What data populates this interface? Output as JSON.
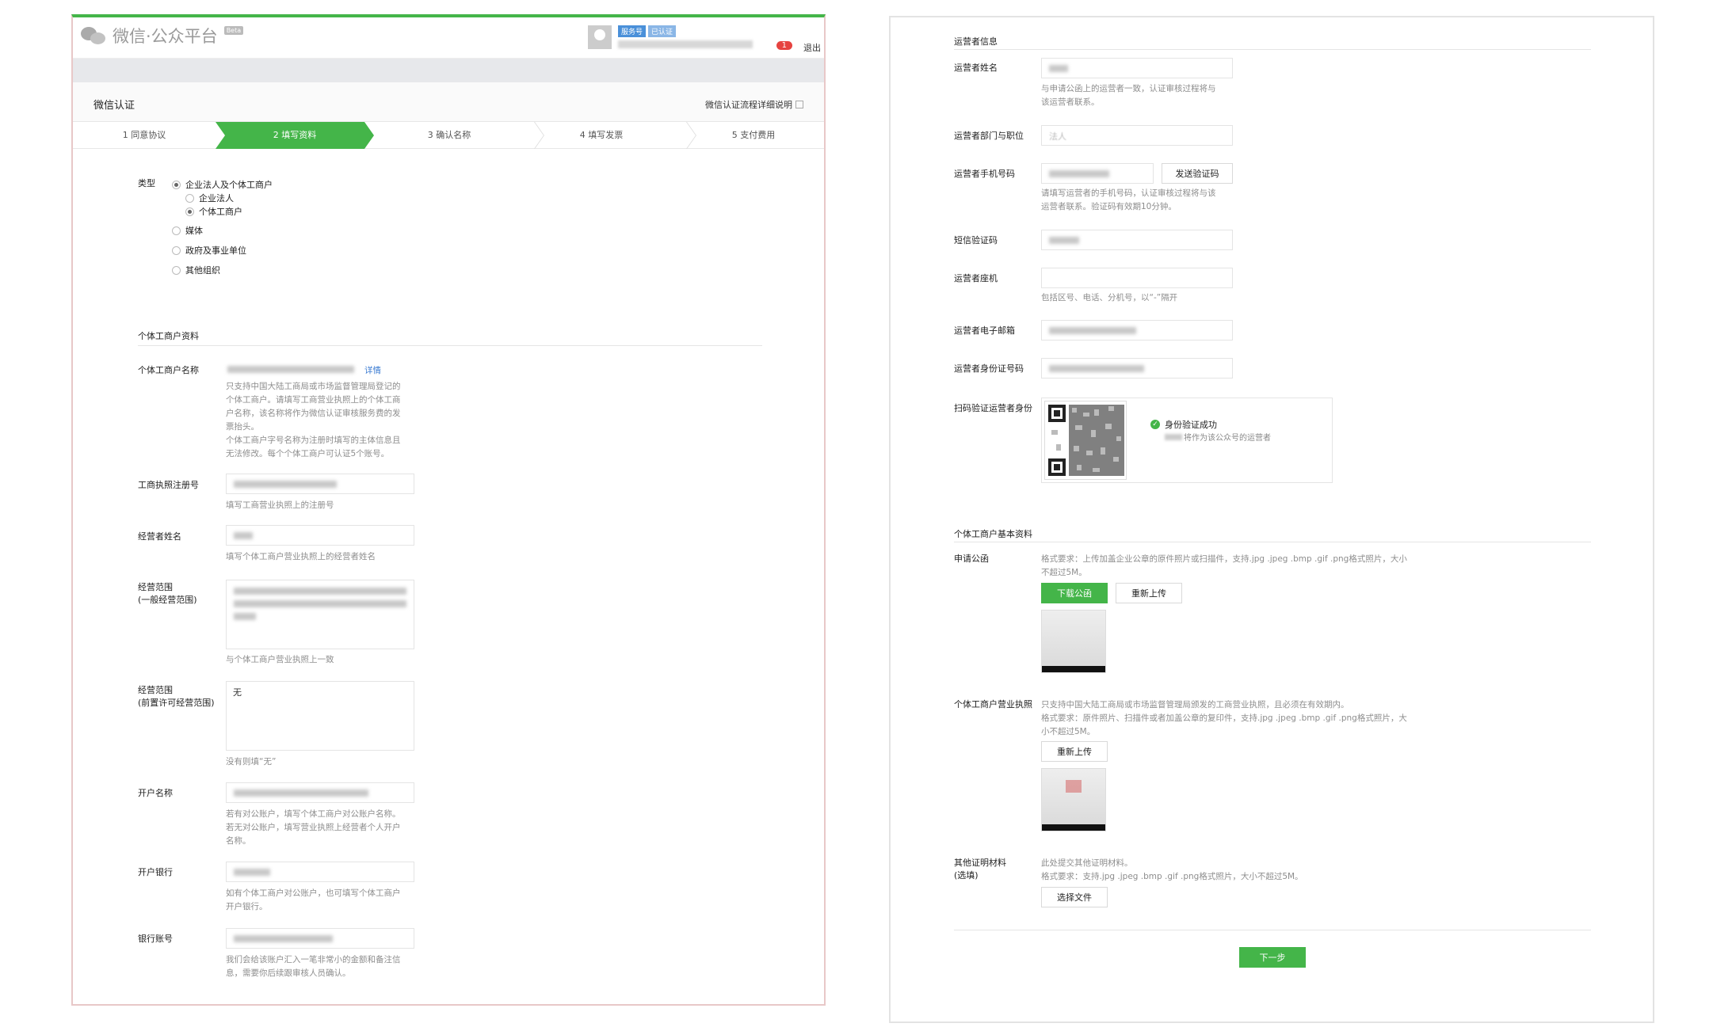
{
  "left": {
    "logo_text": "微信·公众平台",
    "beta": "Beta",
    "user_tags": [
      "服务号",
      "已认证"
    ],
    "badge": "1",
    "logout": "退出",
    "page_title": "微信认证",
    "process_link": "微信认证流程详细说明",
    "steps": [
      "1 同意协议",
      "2 填写资料",
      "3 确认名称",
      "4 填写发票",
      "5 支付费用"
    ],
    "type_label": "类型",
    "types": {
      "main": "企业法人及个体工商户",
      "sub1": "企业法人",
      "sub2": "个体工商户",
      "media": "媒体",
      "gov": "政府及事业单位",
      "other": "其他组织"
    },
    "section_title": "个体工商户资料",
    "fields": {
      "name_label": "个体工商户名称",
      "name_link": "详情",
      "name_hint": [
        "只支持中国大陆工商局或市场监督管理局登记的",
        "个体工商户。请填写工商营业执照上的个体工商",
        "户名称，该名称将作为微信认证审核服务费的发",
        "票抬头。",
        "个体工商户字号名称为注册时填写的主体信息且",
        "无法修改。每个个体工商户可认证5个账号。"
      ],
      "reg_label": "工商执照注册号",
      "reg_hint": "填写工商营业执照上的注册号",
      "operator_label": "经营者姓名",
      "operator_hint": "填写个体工商户营业执照上的经营者姓名",
      "scope1_label": [
        "经营范围",
        "(一般经营范围)"
      ],
      "scope1_hint": "与个体工商户营业执照上一致",
      "scope2_label": [
        "经营范围",
        "(前置许可经营范围)"
      ],
      "scope2_value": "无",
      "scope2_hint": "没有则填“无”",
      "account_name_label": "开户名称",
      "account_name_hint": [
        "若有对公账户，填写个体工商户对公账户名称。",
        "若无对公账户，填写营业执照上经营者个人开户",
        "名称。"
      ],
      "bank_label": "开户银行",
      "bank_hint": [
        "如有个体工商户对公账户，也可填写个体工商户",
        "开户银行。"
      ],
      "bank_acc_label": "银行账号",
      "bank_acc_hint": [
        "我们会给该账户汇入一笔非常小的金额和备注信",
        "息，需要你后续跟审核人员确认。"
      ]
    }
  },
  "right": {
    "section1": "运营者信息",
    "op_name_label": "运营者姓名",
    "op_name_hint": [
      "与申请公函上的运营者一致，认证审核过程将与",
      "该运营者联系。"
    ],
    "op_dept_label": "运营者部门与职位",
    "op_dept_value": "法人",
    "op_phone_label": "运营者手机号码",
    "send_code": "发送验证码",
    "op_phone_hint": [
      "请填写运营者的手机号码，认证审核过程将与该",
      "运营者联系。验证码有效期10分钟。"
    ],
    "sms_label": "短信验证码",
    "landline_label": "运营者座机",
    "landline_hint": "包括区号、电话、分机号，以“-”隔开",
    "email_label": "运营者电子邮箱",
    "id_label": "运营者身份证号码",
    "scan_label": "扫码验证运营者身份",
    "verify_ok": "身份验证成功",
    "verify_sub": "将作为该公众号的运营者",
    "section2": "个体工商户基本资料",
    "letter_label": "申请公函",
    "letter_hint": [
      "格式要求：上传加盖企业公章的原件照片或扫描件，支持.jpg .jpeg .bmp .gif .png格式照片，大小",
      "不超过5M。"
    ],
    "download_btn": "下载公函",
    "reupload_btn": "重新上传",
    "license_label": "个体工商户营业执照",
    "license_hint": [
      "只支持中国大陆工商局或市场监督管理局颁发的工商营业执照，且必须在有效期内。",
      "格式要求：原件照片、扫描件或者加盖公章的复印件，支持.jpg .jpeg .bmp .gif .png格式照片，大",
      "小不超过5M。"
    ],
    "reupload_btn2": "重新上传",
    "other_label": [
      "其他证明材料",
      "(选填)"
    ],
    "other_hint": [
      "此处提交其他证明材料。",
      "格式要求：支持.jpg .jpeg .bmp .gif .png格式照片，大小不超过5M。"
    ],
    "choose_file": "选择文件",
    "next": "下一步"
  },
  "colors": {
    "accent": "#44b549",
    "badge": "#e64340",
    "tag1": "#4a90d9",
    "tag2": "#8ab6e6"
  }
}
